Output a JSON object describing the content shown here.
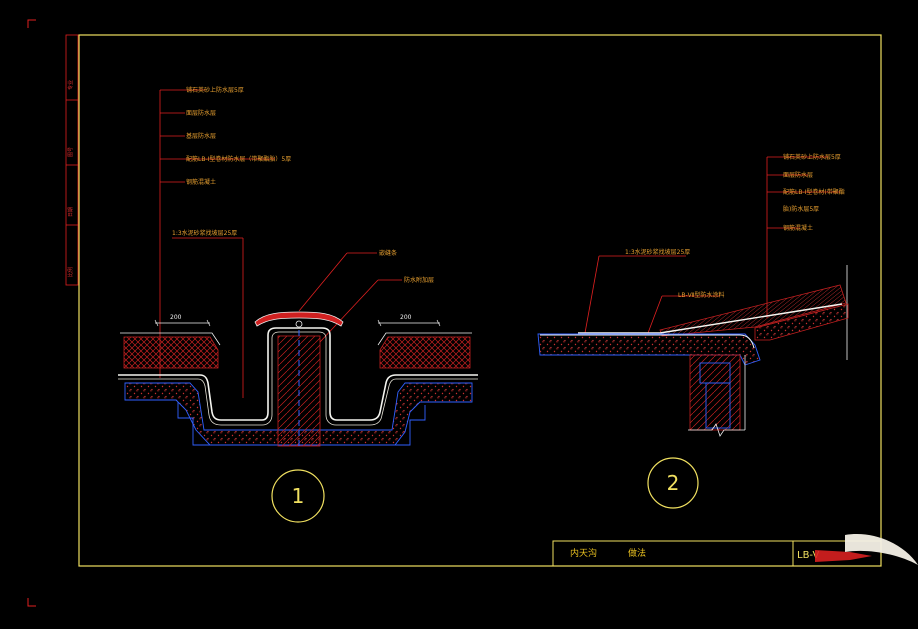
{
  "colors": {
    "background": "#000000",
    "frame": "#f0e060",
    "leader": "#e02020",
    "hatch": "#d02020",
    "concrete_outline": "#3060ff",
    "membrane": "#f5f5f0",
    "text": "#e8a030",
    "circle": "#f0e060"
  },
  "title_block": {
    "left_text": "内天沟",
    "right_text": "做法",
    "drawing_no": "LB-V"
  },
  "side_strip": {
    "labels": [
      "专业",
      "图号",
      "日期",
      "比例"
    ]
  },
  "detail_1": {
    "circle_label": "1",
    "dimension_left": "200",
    "dimension_right": "200",
    "labels": [
      "铺石英砂上防水层5厚",
      "面层防水层",
      "基层防水层",
      "配筋LB-Ⅰ型卷材防水层（带聚酯胎）5厚",
      "钢筋混凝土",
      "1:3水泥砂浆找坡层25厚",
      "嵌缝条",
      "防水附加层"
    ]
  },
  "detail_2": {
    "circle_label": "2",
    "labels": [
      "铺石英砂上防水层5厚",
      "面层防水层",
      "配筋LB-Ⅰ型卷材(带聚酯",
      "胎)防水层5厚",
      "钢筋混凝土",
      "1:3水泥砂浆找坡层25厚",
      "LB-Ⅶ型防水涂料"
    ]
  }
}
